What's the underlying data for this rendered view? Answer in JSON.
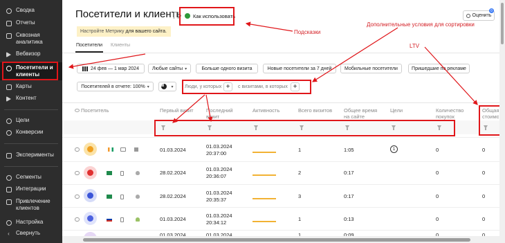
{
  "sidebar": {
    "items": [
      {
        "label": "Сводка",
        "icon": "dashboard-icon"
      },
      {
        "label": "Отчеты",
        "icon": "reports-icon"
      },
      {
        "label": "Сквозная аналитика",
        "icon": "analytics-icon"
      },
      {
        "label": "Вебвизор",
        "icon": "play-icon"
      },
      {
        "label": "Посетители и клиенты",
        "icon": "visitors-icon"
      },
      {
        "label": "Карты",
        "icon": "map-icon"
      },
      {
        "label": "Контент",
        "icon": "content-icon"
      },
      {
        "label": "Цели",
        "icon": "target-icon"
      },
      {
        "label": "Конверсии",
        "icon": "conversions-icon"
      },
      {
        "label": "Эксперименты",
        "icon": "experiments-icon"
      },
      {
        "label": "Сегменты",
        "icon": "segments-icon"
      },
      {
        "label": "Интеграции",
        "icon": "integrations-icon"
      },
      {
        "label": "Привлечение клиентов",
        "icon": "acquisition-icon"
      },
      {
        "label": "Настройка",
        "icon": "gear-icon"
      },
      {
        "label": "Свернуть",
        "icon": "collapse-icon"
      }
    ]
  },
  "header": {
    "title": "Посетители и клиенты",
    "howto_label": "Как использовать",
    "rate_label": "Оценить",
    "rate_badge": "0"
  },
  "notice": {
    "text": "Настройте Метрику",
    "link": "для вашего сайта."
  },
  "tabs": [
    {
      "label": "Посетители"
    },
    {
      "label": "Клиенты"
    }
  ],
  "toolbar": {
    "date_range": "24 фев — 1 мар 2024",
    "filters": [
      "Любые сайты",
      "Больше одного визита",
      "Новые посетители за 7 дней",
      "Мобильные посетители",
      "Пришедшие по рекламе"
    ],
    "visitors_in_report": "Посетителей в отчете: 100%",
    "segment_left": "Люди, у которых",
    "segment_right": "с визитами, в которых"
  },
  "table": {
    "columns": [
      "Посетитель",
      "Первый визит",
      "Последний визит",
      "Активность",
      "Всего визитов",
      "Общее время на сайте",
      "Цели",
      "Количество покупок",
      "Общая стоимость покупок"
    ],
    "rows": [
      {
        "first": "01.03.2024",
        "last_date": "01.03.2024",
        "last_time": "20:37:00",
        "visits": "1",
        "time": "1:05",
        "goals": "1",
        "purchases": "0",
        "total": "0"
      },
      {
        "first": "28.02.2024",
        "last_date": "01.03.2024",
        "last_time": "20:36:07",
        "visits": "2",
        "time": "0:17",
        "goals": "",
        "purchases": "0",
        "total": "0"
      },
      {
        "first": "28.02.2024",
        "last_date": "01.03.2024",
        "last_time": "20:35:37",
        "visits": "3",
        "time": "0:17",
        "goals": "",
        "purchases": "0",
        "total": "0"
      },
      {
        "first": "01.03.2024",
        "last_date": "01.03.2024",
        "last_time": "20:34:12",
        "visits": "1",
        "time": "0:13",
        "goals": "",
        "purchases": "0",
        "total": "0"
      },
      {
        "first": "01.03.2024",
        "last_date": "01.03.2024",
        "last_time": "",
        "visits": "1",
        "time": "0:09",
        "goals": "",
        "purchases": "0",
        "total": "0"
      }
    ]
  },
  "annotations": {
    "hints": "Подсказки",
    "extra_sort": "Дополнительные условия для сортировки",
    "ltv": "LTV"
  },
  "colors": {
    "sidebar_bg": "#2d2d2d",
    "annotation_red": "#e0161a",
    "notice_bg": "#fdf1c7",
    "spark": "#f2b233"
  }
}
